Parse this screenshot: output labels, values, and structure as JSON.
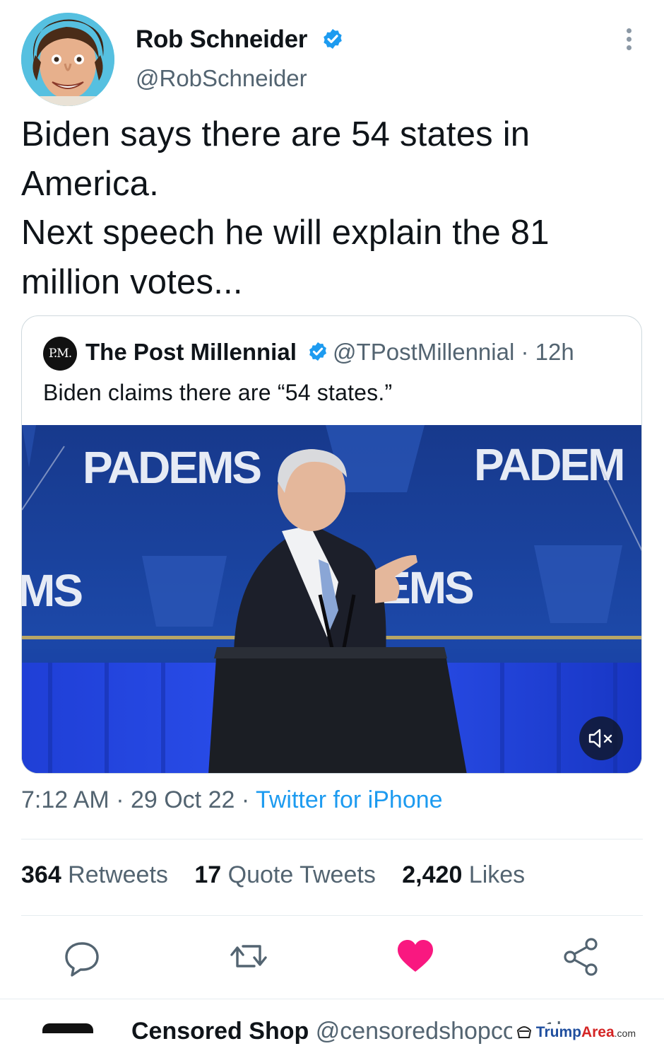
{
  "tweet": {
    "author_name": "Rob Schneider",
    "author_handle": "@RobSchneider",
    "verified": true,
    "text": "Biden says there are 54 states in\nAmerica.\nNext speech he will explain the 81\nmillion votes...",
    "timestamp": "7:12 AM · 29 Oct 22 · ",
    "source": "Twitter for iPhone"
  },
  "quoted_tweet": {
    "avatar_text": "P.M.",
    "author_name": "The Post Millennial",
    "author_handle": "@TPostMillennial",
    "separator": " · ",
    "age": "12h",
    "text": "Biden claims there are “54 states.”",
    "video": {
      "backdrop_text_left": "PADEMS",
      "backdrop_text_right": "PADEM",
      "backdrop_text_mid_left": "MS",
      "backdrop_text_mid_right": "EMS",
      "muted": true
    }
  },
  "stats": [
    {
      "count": "364",
      "label": " Retweets"
    },
    {
      "count": "17",
      "label": " Quote Tweets"
    },
    {
      "count": "2,420",
      "label": " Likes"
    }
  ],
  "actions": [
    "reply-icon",
    "retweet-icon",
    "like-icon",
    "share-icon"
  ],
  "liked": true,
  "next_tweet_preview": {
    "author_name": "Censored Shop",
    "author_handle": "@censoredshopcom",
    "age": "1h"
  },
  "watermark": {
    "brand_a": "Trump",
    "brand_b": "Area",
    "suffix": ".com"
  },
  "colors": {
    "accent": "#1d9bf0",
    "like": "#f91880",
    "muted_text": "#536471",
    "text": "#0f1419"
  }
}
